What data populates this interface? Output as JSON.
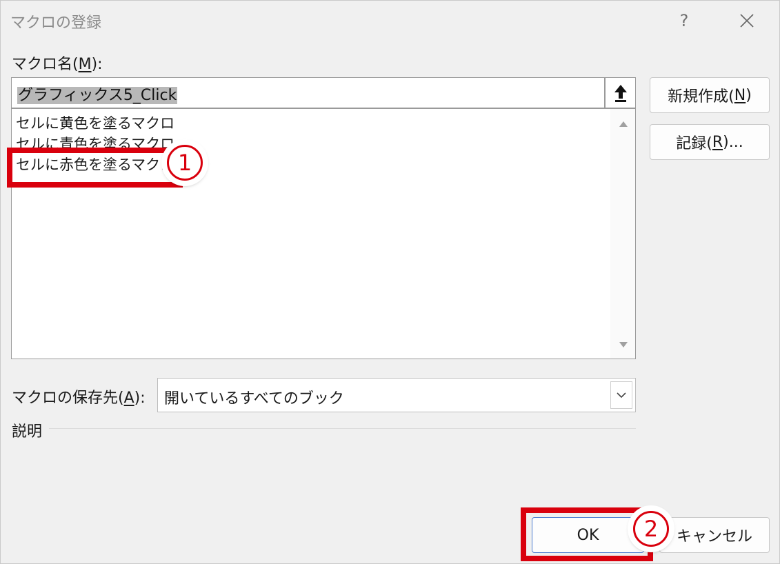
{
  "window": {
    "title": "マクロの登録",
    "help_glyph": "?",
    "close_glyph": "✕"
  },
  "macro_name": {
    "label_prefix": "マクロ名(",
    "label_key": "M",
    "label_suffix": "):",
    "value": "グラフィックス5_Click"
  },
  "macro_list": {
    "items": [
      "セルに黄色を塗るマクロ",
      "セルに青色を塗るマクロ",
      "セルに赤色を塗るマクロ"
    ]
  },
  "buttons": {
    "new_prefix": "新規作成(",
    "new_key": "N",
    "new_suffix": ")",
    "record_prefix": "記録(",
    "record_key": "R",
    "record_suffix": ")...",
    "ok": "OK",
    "cancel": "キャンセル"
  },
  "save_location": {
    "label_prefix": "マクロの保存先(",
    "label_key": "A",
    "label_suffix": "):",
    "value": "開いているすべてのブック"
  },
  "description": {
    "label": "説明"
  },
  "annotations": {
    "step1": "1",
    "step2": "2",
    "color": "#d9000d"
  }
}
